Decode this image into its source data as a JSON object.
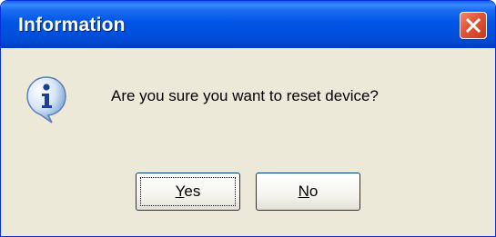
{
  "window": {
    "title": "Information",
    "close_icon": "close-icon"
  },
  "dialog": {
    "icon": "info-icon",
    "message": "Are you sure you want to reset device?"
  },
  "buttons": {
    "yes": {
      "first": "Y",
      "rest": "es"
    },
    "no": {
      "first": "N",
      "rest": "o"
    }
  },
  "colors": {
    "titlebar": "#0055e5",
    "close": "#e2583a",
    "dialog_bg": "#ece9d8"
  }
}
